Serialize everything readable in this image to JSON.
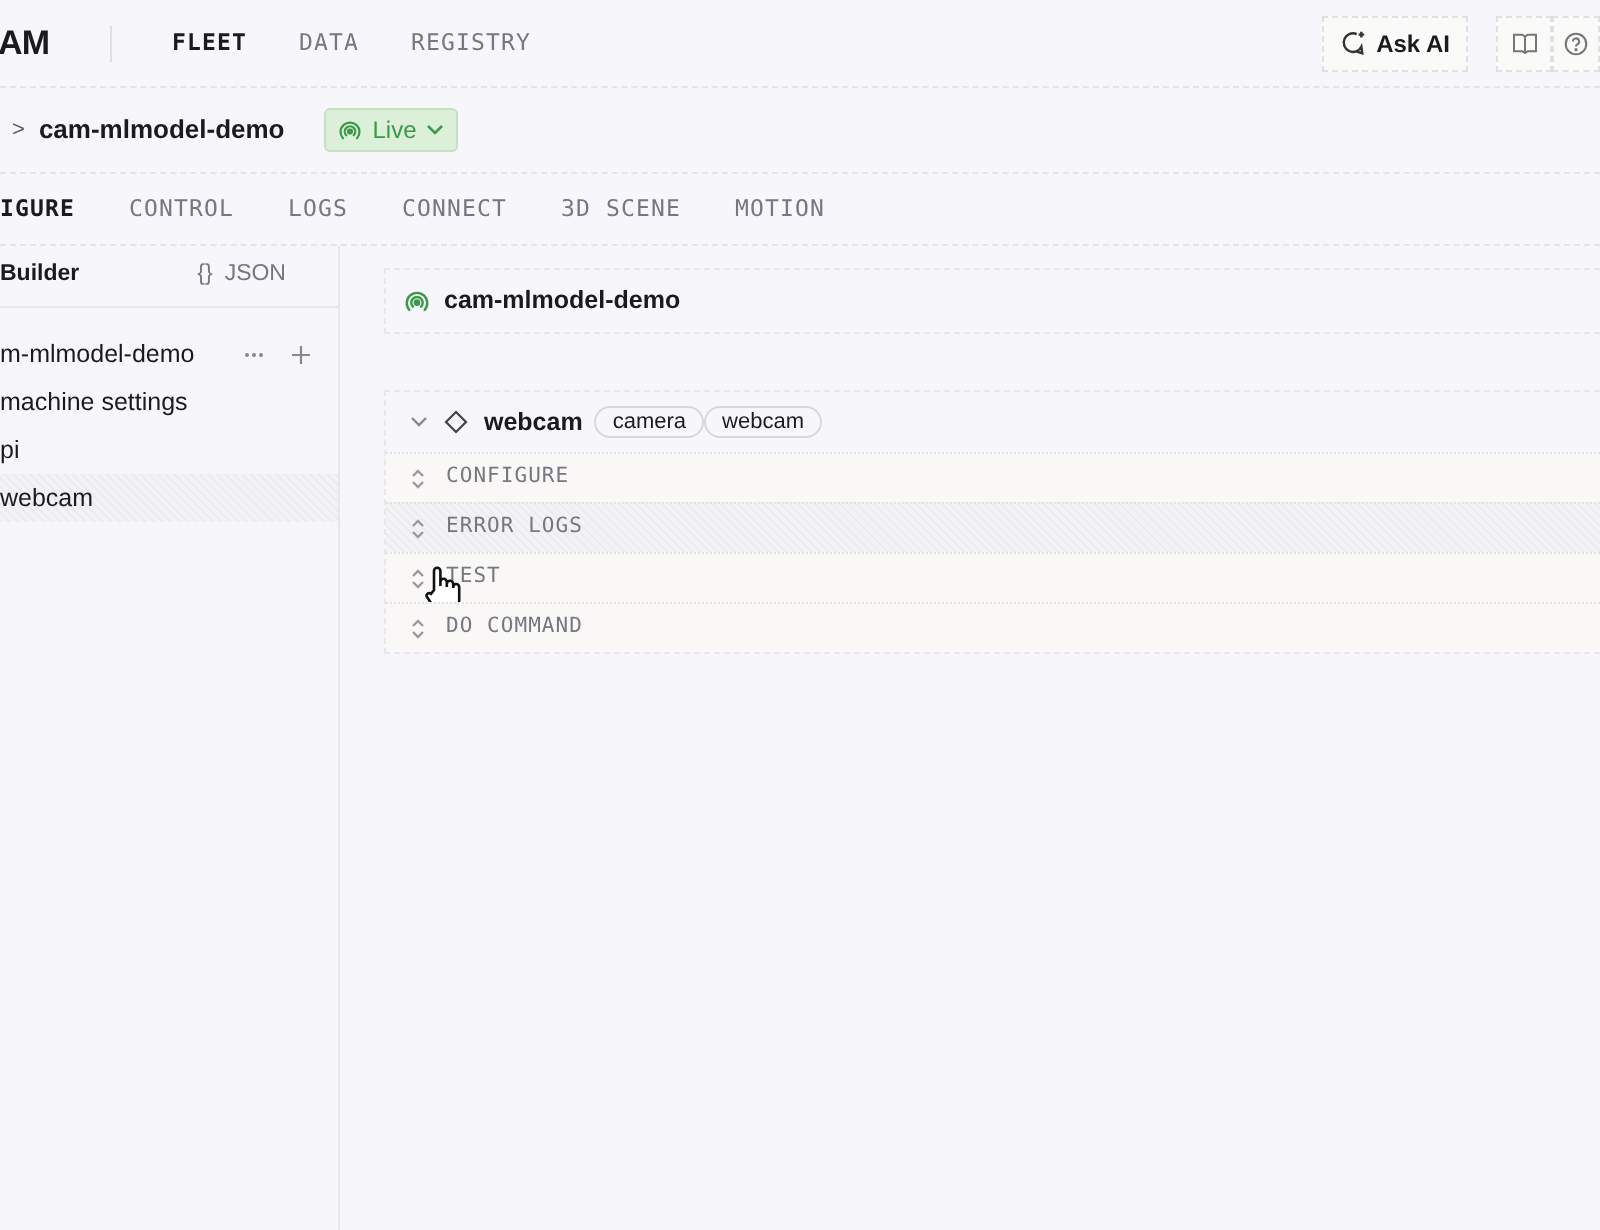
{
  "logo": "AM",
  "nav": [
    {
      "label": "FLEET",
      "selected": true
    },
    {
      "label": "DATA",
      "selected": false
    },
    {
      "label": "REGISTRY",
      "selected": false
    }
  ],
  "ask_ai": "Ask AI",
  "breadcrumb": {
    "separator": ">",
    "machine": "cam-mlmodel-demo",
    "status": "Live"
  },
  "tabs": [
    {
      "label": "IGURE",
      "selected": true
    },
    {
      "label": "CONTROL",
      "selected": false
    },
    {
      "label": "LOGS",
      "selected": false
    },
    {
      "label": "CONNECT",
      "selected": false
    },
    {
      "label": "3D SCENE",
      "selected": false
    },
    {
      "label": "MOTION",
      "selected": false
    }
  ],
  "view_modes": [
    {
      "label": "Builder",
      "selected": true
    },
    {
      "label": "JSON",
      "icon": "{}",
      "selected": false
    }
  ],
  "tree": [
    {
      "label": "m-mlmodel-demo",
      "kind": "root",
      "selected": false
    },
    {
      "label": "machine settings",
      "kind": "item",
      "selected": false
    },
    {
      "label": "pi",
      "kind": "item",
      "selected": false
    },
    {
      "label": "webcam",
      "kind": "item",
      "selected": true
    }
  ],
  "machine_card": {
    "name": "cam-mlmodel-demo"
  },
  "component": {
    "name": "webcam",
    "tags": [
      "camera",
      "webcam"
    ],
    "expanded": true,
    "sections": [
      {
        "label": "CONFIGURE",
        "selected": false
      },
      {
        "label": "ERROR LOGS",
        "selected": true
      },
      {
        "label": "TEST",
        "selected": false
      },
      {
        "label": "DO COMMAND",
        "selected": false
      }
    ]
  }
}
